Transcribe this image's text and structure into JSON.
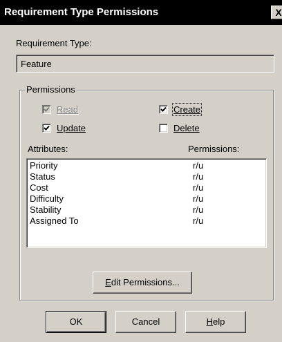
{
  "window": {
    "title": "Requirement Type Permissions",
    "close_glyph": "X"
  },
  "requirement_type": {
    "label": "Requirement Type:",
    "value": "Feature"
  },
  "permissions_group": {
    "legend": "Permissions",
    "checkboxes": [
      {
        "label": "Read",
        "checked": true,
        "enabled": false
      },
      {
        "label": "Create",
        "checked": true,
        "enabled": true
      },
      {
        "label": "Update",
        "checked": true,
        "enabled": true
      },
      {
        "label": "Delete",
        "checked": false,
        "enabled": true
      }
    ],
    "list": {
      "columns": [
        "Attributes:",
        "Permissions:"
      ],
      "rows": [
        {
          "attribute": "Priority",
          "permission": "r/u"
        },
        {
          "attribute": "Status",
          "permission": "r/u"
        },
        {
          "attribute": "Cost",
          "permission": "r/u"
        },
        {
          "attribute": "Difficulty",
          "permission": "r/u"
        },
        {
          "attribute": "Stability",
          "permission": "r/u"
        },
        {
          "attribute": "Assigned To",
          "permission": "r/u"
        }
      ]
    },
    "edit_button": {
      "accel": "E",
      "rest": "dit Permissions..."
    }
  },
  "footer": {
    "ok_label": "OK",
    "cancel_label": "Cancel",
    "help_accel": "H",
    "help_rest": "elp"
  }
}
